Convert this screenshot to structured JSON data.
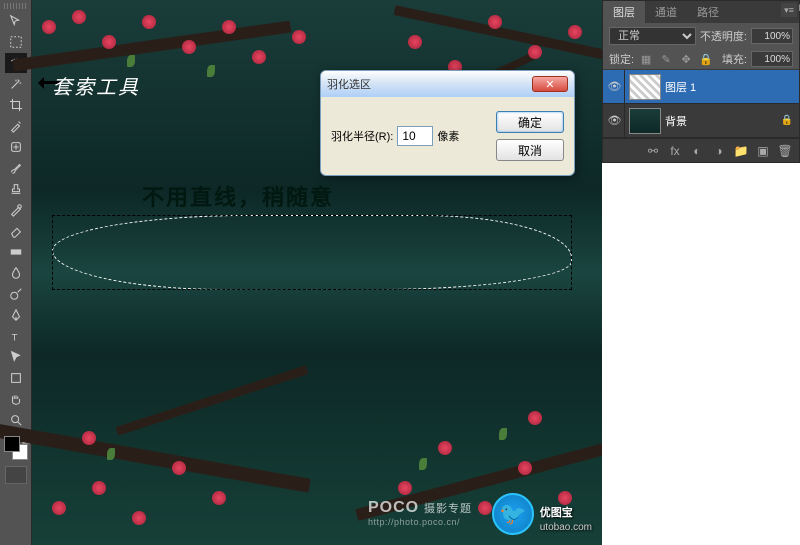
{
  "toolbox": {
    "tools": [
      "move",
      "marquee",
      "lasso",
      "wand",
      "crop",
      "eyedropper",
      "healing",
      "brush",
      "stamp",
      "history-brush",
      "eraser",
      "gradient",
      "blur",
      "dodge",
      "pen",
      "type",
      "path-select",
      "rectangle",
      "hand",
      "zoom"
    ]
  },
  "annotations": {
    "lasso_label": "套索工具",
    "freehand_hint": "不用直线，稍随意"
  },
  "dialog": {
    "title": "羽化选区",
    "radius_label": "羽化半径(R):",
    "radius_value": "10",
    "unit": "像素",
    "ok": "确定",
    "cancel": "取消"
  },
  "layers_panel": {
    "tabs": [
      "图层",
      "通道",
      "路径"
    ],
    "blend_mode": "正常",
    "opacity_label": "不透明度:",
    "opacity_value": "100%",
    "lock_label": "锁定:",
    "fill_label": "填充:",
    "fill_value": "100%",
    "layers": [
      {
        "name": "图层 1",
        "visible": true,
        "selected": true,
        "locked": false,
        "thumb": "trans"
      },
      {
        "name": "背景",
        "visible": true,
        "selected": false,
        "locked": true,
        "thumb": "img"
      }
    ]
  },
  "watermark": {
    "poco_brand": "POCO",
    "poco_text": "摄影专题",
    "poco_url": "http://photo.poco.cn/",
    "utb_text": "优图宝",
    "utb_url": "utobao.com"
  }
}
